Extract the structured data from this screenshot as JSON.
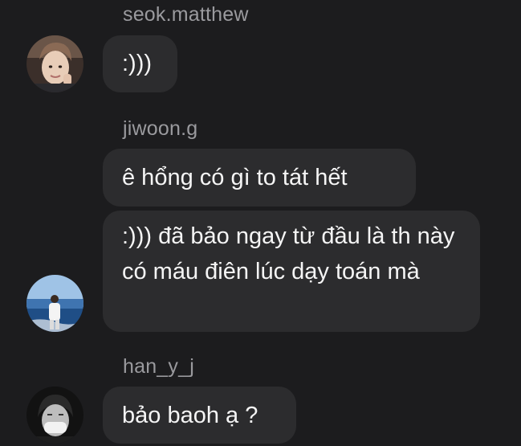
{
  "messages": [
    {
      "username": "seok.matthew",
      "bubbles": [
        ":)))"
      ],
      "avatar_icon": "profile-photo-smiling-person"
    },
    {
      "username": "jiwoon.g",
      "bubbles": [
        "ê hổng có gì to tát hết",
        ":))) đã bảo ngay từ đầu là th này có máu điên lúc dạy toán mà"
      ],
      "avatar_icon": "profile-photo-beach-person"
    },
    {
      "username": "han_y_j",
      "bubbles": [
        "bảo baoh ạ ?"
      ],
      "avatar_icon": "profile-photo-masked-person"
    }
  ],
  "colors": {
    "background": "#1c1c1e",
    "bubble": "#2c2c2e",
    "username": "#9a9a9e",
    "text": "#f5f5f5"
  }
}
